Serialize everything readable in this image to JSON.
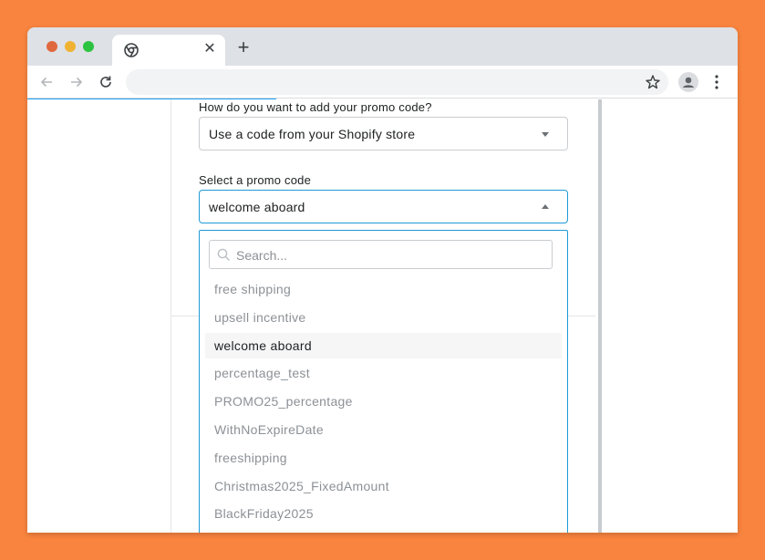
{
  "browser": {
    "tab_close": "✕",
    "new_tab": "+"
  },
  "form": {
    "method_label": "How do you want to add your promo code?",
    "method_value": "Use a code from your Shopify store",
    "promo_label": "Select a promo code",
    "promo_value": "welcome aboard"
  },
  "dropdown": {
    "search_placeholder": "Search...",
    "options": [
      {
        "label": "free shipping"
      },
      {
        "label": "upsell incentive"
      },
      {
        "label": "welcome aboard",
        "selected": true
      },
      {
        "label": "percentage_test"
      },
      {
        "label": "PROMO25_percentage"
      },
      {
        "label": "WithNoExpireDate"
      },
      {
        "label": "freeshipping"
      },
      {
        "label": "Christmas2025_FixedAmount"
      },
      {
        "label": "BlackFriday2025"
      }
    ]
  },
  "colors": {
    "background": "#f8843f",
    "accent": "#1e9ad6",
    "progress": "#1da1f2"
  },
  "icons": [
    "chrome-icon",
    "close-icon",
    "plus-icon",
    "back-arrow-icon",
    "forward-arrow-icon",
    "reload-icon",
    "star-icon",
    "profile-icon",
    "kebab-menu-icon",
    "search-icon",
    "caret-down-icon",
    "caret-up-icon"
  ]
}
